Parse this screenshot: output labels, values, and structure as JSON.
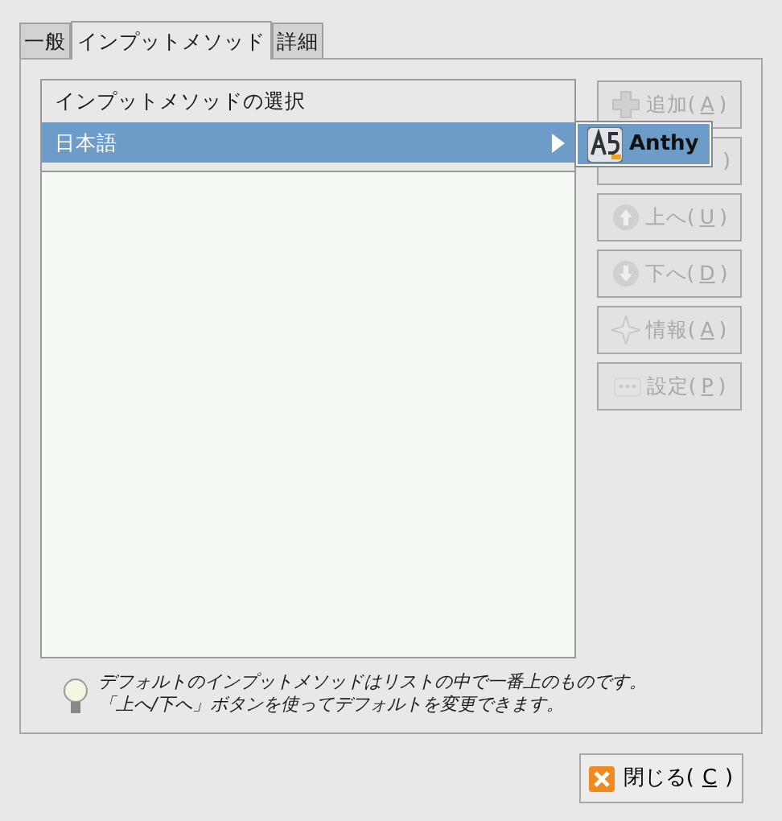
{
  "tabs": [
    {
      "label": "一般",
      "selected": false
    },
    {
      "label": "インプットメソッド",
      "selected": true
    },
    {
      "label": "詳細",
      "selected": false
    }
  ],
  "list": {
    "header": "インプットメソッドの選択",
    "rows": [
      {
        "label": "日本語",
        "selected": true,
        "expanded": true
      }
    ]
  },
  "submenu": {
    "items": [
      {
        "label": "Anthy",
        "selected": true
      }
    ]
  },
  "side_buttons": [
    {
      "kind": "add",
      "before": "追加(",
      "mnemonic": "A",
      "after": ")",
      "disabled": true
    },
    {
      "kind": "hidden",
      "before": ")",
      "disabled": true
    },
    {
      "kind": "up",
      "before": "上へ(",
      "mnemonic": "U",
      "after": ")",
      "disabled": true
    },
    {
      "kind": "down",
      "before": "下へ(",
      "mnemonic": "D",
      "after": ")",
      "disabled": true
    },
    {
      "kind": "info",
      "before": "情報(",
      "mnemonic": "A",
      "after": ")",
      "disabled": true
    },
    {
      "kind": "settings",
      "before": "設定(",
      "mnemonic": "P",
      "after": ")",
      "disabled": true
    }
  ],
  "hint": [
    "デフォルトのインプットメソッドはリストの中で一番上のものです。",
    "「上へ/下へ」ボタンを使ってデフォルトを変更できます。"
  ],
  "close_button": {
    "before": "閉じる(",
    "mnemonic": "C",
    "after": ")",
    "disabled": false
  }
}
